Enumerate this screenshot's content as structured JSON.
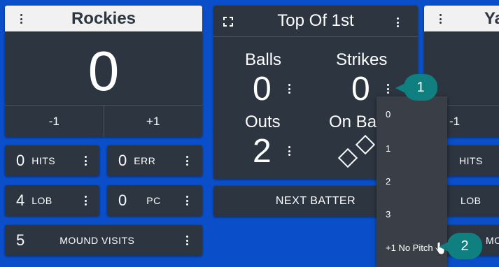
{
  "left_team": {
    "name": "Rockies",
    "score": "0",
    "minus_label": "-1",
    "plus_label": "+1"
  },
  "left_stats": {
    "hits": {
      "value": "0",
      "label": "HITS"
    },
    "err": {
      "value": "0",
      "label": "ERR"
    },
    "lob": {
      "value": "4",
      "label": "LOB"
    },
    "pc": {
      "value": "0",
      "label": "PC"
    },
    "mound_visits": {
      "value": "5",
      "label": "MOUND VISITS"
    }
  },
  "inning": {
    "title": "Top Of 1st",
    "balls_label": "Balls",
    "balls_value": "0",
    "strikes_label": "Strikes",
    "strikes_value": "0",
    "outs_label": "Outs",
    "outs_value": "2",
    "onbase_label": "On Ba"
  },
  "next_batter_label": "NEXT BATTER",
  "right_team": {
    "name_partial": "Ya",
    "minus_label": "-1",
    "hits_label": "HITS",
    "lob_label": "LOB",
    "mound_label_partial": "MOU"
  },
  "strikes_dropdown": {
    "options": [
      "0",
      "1",
      "2",
      "3",
      "+1 No Pitch"
    ]
  },
  "callouts": [
    "1",
    "2"
  ],
  "colors": {
    "background": "#0a4fc9",
    "card": "#2d3541",
    "header_light": "#f1f1f1",
    "callout": "#0f7f80",
    "dropdown": "#3a3f47"
  },
  "icons": [
    "kebab-menu-icon",
    "expand-icon",
    "bases-diamond-icon",
    "hand-cursor-icon"
  ]
}
